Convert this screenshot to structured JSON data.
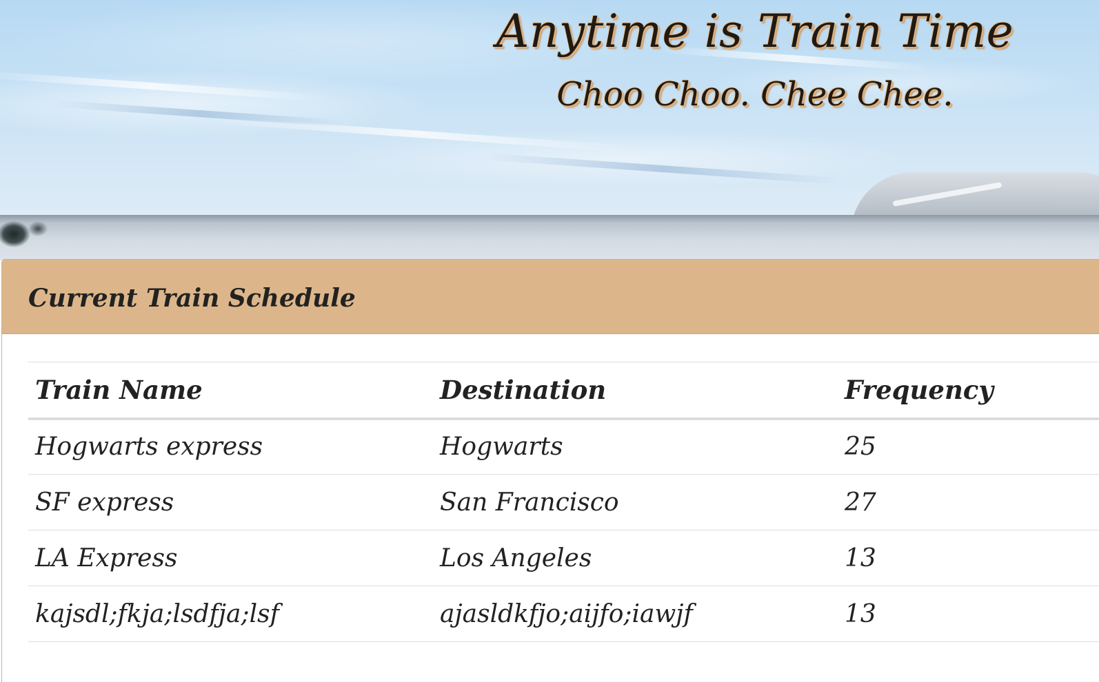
{
  "header": {
    "title": "Anytime is Train Time",
    "subtitle": "Choo Choo. Chee Chee."
  },
  "schedule": {
    "heading": "Current Train Schedule",
    "columns": [
      "Train Name",
      "Destination",
      "Frequency"
    ],
    "rows": [
      {
        "name": "Hogwarts express",
        "destination": "Hogwarts",
        "frequency": "25"
      },
      {
        "name": "SF express",
        "destination": "San Francisco",
        "frequency": "27"
      },
      {
        "name": "LA Express",
        "destination": "Los Angeles",
        "frequency": "13"
      },
      {
        "name": "kajsdl;fkja;lsdfja;lsf",
        "destination": "ajasldkfjo;aijfo;iawjf",
        "frequency": "13"
      }
    ]
  },
  "colors": {
    "panel_heading_bg": "#dcb68a",
    "title_shadow": "#e0b07c",
    "sky": "#c6e1f5"
  }
}
